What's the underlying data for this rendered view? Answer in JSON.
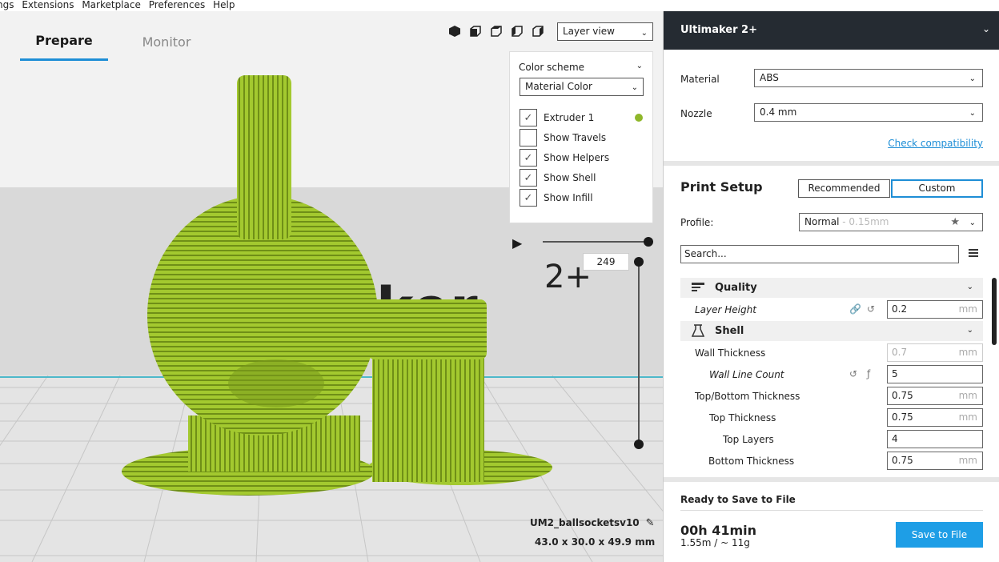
{
  "menu": [
    "ngs",
    "Extensions",
    "Marketplace",
    "Preferences",
    "Help"
  ],
  "stages": {
    "prepare": "Prepare",
    "monitor": "Monitor"
  },
  "view": {
    "selected": "Layer view"
  },
  "layer_panel": {
    "color_scheme_label": "Color scheme",
    "color_scheme_value": "Material Color",
    "options": [
      {
        "label": "Extruder 1",
        "checked": true
      },
      {
        "label": "Show Travels",
        "checked": false
      },
      {
        "label": "Show Helpers",
        "checked": true
      },
      {
        "label": "Show Shell",
        "checked": true
      },
      {
        "label": "Show Infill",
        "checked": true
      }
    ],
    "extruder_color": "#8fb72a"
  },
  "layer_slider": {
    "current_layer": "249"
  },
  "scene": {
    "logo_text": "ker",
    "logo_suffix": "2+"
  },
  "model": {
    "name": "UM2_ballsocketsv10",
    "dimensions": "43.0 x 30.0 x 49.9 mm"
  },
  "printer": {
    "name": "Ultimaker 2+"
  },
  "material": {
    "label": "Material",
    "value": "ABS"
  },
  "nozzle": {
    "label": "Nozzle",
    "value": "0.4 mm"
  },
  "check_compatibility": "Check compatibility",
  "print_setup": {
    "title": "Print Setup",
    "recommended": "Recommended",
    "custom": "Custom",
    "profile_label": "Profile:",
    "profile_value": "Normal",
    "profile_sub": " - 0.15mm",
    "search_placeholder": "Search..."
  },
  "settings": {
    "quality": {
      "label": "Quality",
      "layer_height": {
        "label": "Layer Height",
        "value": "0.2",
        "unit": "mm"
      }
    },
    "shell": {
      "label": "Shell",
      "wall_thickness": {
        "label": "Wall Thickness",
        "value": "0.7",
        "unit": "mm"
      },
      "wall_line_count": {
        "label": "Wall Line Count",
        "value": "5"
      },
      "top_bottom_thickness": {
        "label": "Top/Bottom Thickness",
        "value": "0.75",
        "unit": "mm"
      },
      "top_thickness": {
        "label": "Top Thickness",
        "value": "0.75",
        "unit": "mm"
      },
      "top_layers": {
        "label": "Top Layers",
        "value": "4"
      },
      "bottom_thickness": {
        "label": "Bottom Thickness",
        "value": "0.75",
        "unit": "mm"
      }
    }
  },
  "output": {
    "status": "Ready to Save to File",
    "time": "00h 41min",
    "material_usage": "1.55m / ~ 11g",
    "save_button": "Save to File"
  },
  "colors": {
    "accent": "#1e8ed6",
    "model_green": "#9dc12c",
    "header_dark": "#252b32"
  }
}
